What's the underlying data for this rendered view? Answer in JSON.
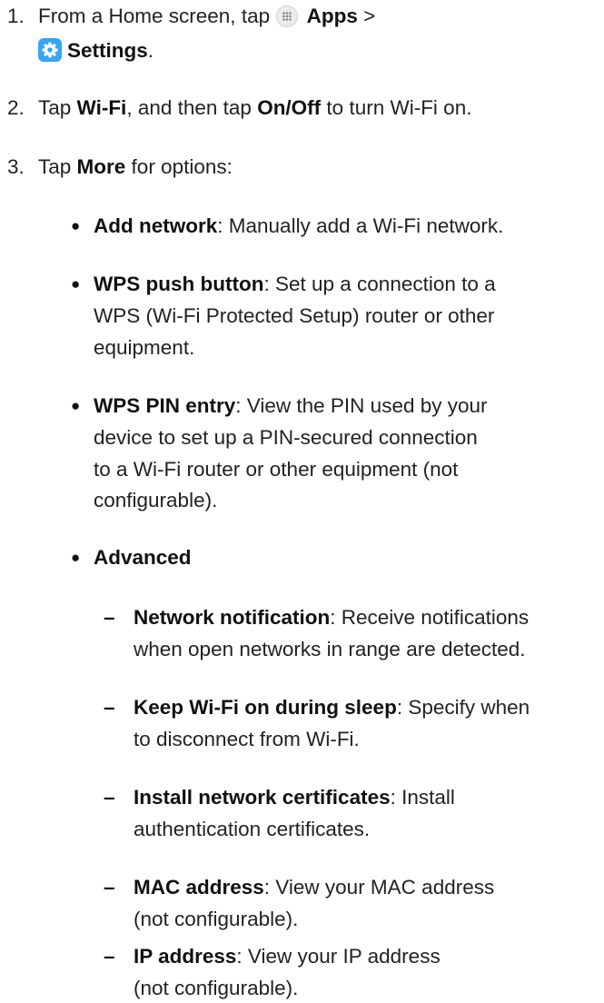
{
  "steps": [
    {
      "number": "1.",
      "line1_prefix": "From a Home screen, tap ",
      "apps_label": "Apps",
      "line1_suffix": " >",
      "settings_label": "Settings",
      "line2_suffix": "."
    },
    {
      "number": "2.",
      "t1": "Tap ",
      "wifi": "Wi-Fi",
      "t2": ", and then tap ",
      "onoff": "On/Off",
      "t3": " to turn Wi-Fi on."
    },
    {
      "number": "3.",
      "t1": "Tap ",
      "more": "More",
      "t2": " for options:"
    }
  ],
  "options": [
    {
      "bullet": "●",
      "title": "Add network",
      "lines": [
        ": Manually add a Wi-Fi network."
      ]
    },
    {
      "bullet": "●",
      "title": "WPS push button",
      "lines": [
        ": Set up a connection to a",
        "WPS (Wi-Fi Protected Setup) router or other",
        "equipment."
      ]
    },
    {
      "bullet": "●",
      "title": "WPS PIN entry",
      "lines": [
        ": View the PIN used by your",
        "device to set up a PIN-secured connection",
        "to a Wi-Fi router or other equipment (not",
        "configurable)."
      ]
    },
    {
      "bullet": "●",
      "title": "Advanced",
      "lines": []
    }
  ],
  "advanced_items": [
    {
      "dash": "–",
      "title": "Network notification",
      "lines": [
        ": Receive notifications",
        "when open networks in range are detected."
      ]
    },
    {
      "dash": "–",
      "title": "Keep Wi-Fi on during sleep",
      "lines": [
        ": Specify when",
        "to disconnect from Wi-Fi."
      ]
    },
    {
      "dash": "–",
      "title": "Install network certificates",
      "lines": [
        ": Install",
        "authentication certificates."
      ]
    },
    {
      "dash": "–",
      "title": "MAC address",
      "lines": [
        ": View your MAC address",
        "(not configurable)."
      ]
    },
    {
      "dash": "–",
      "title": "IP address",
      "lines": [
        ": View your IP address",
        "(not configurable)."
      ]
    }
  ]
}
